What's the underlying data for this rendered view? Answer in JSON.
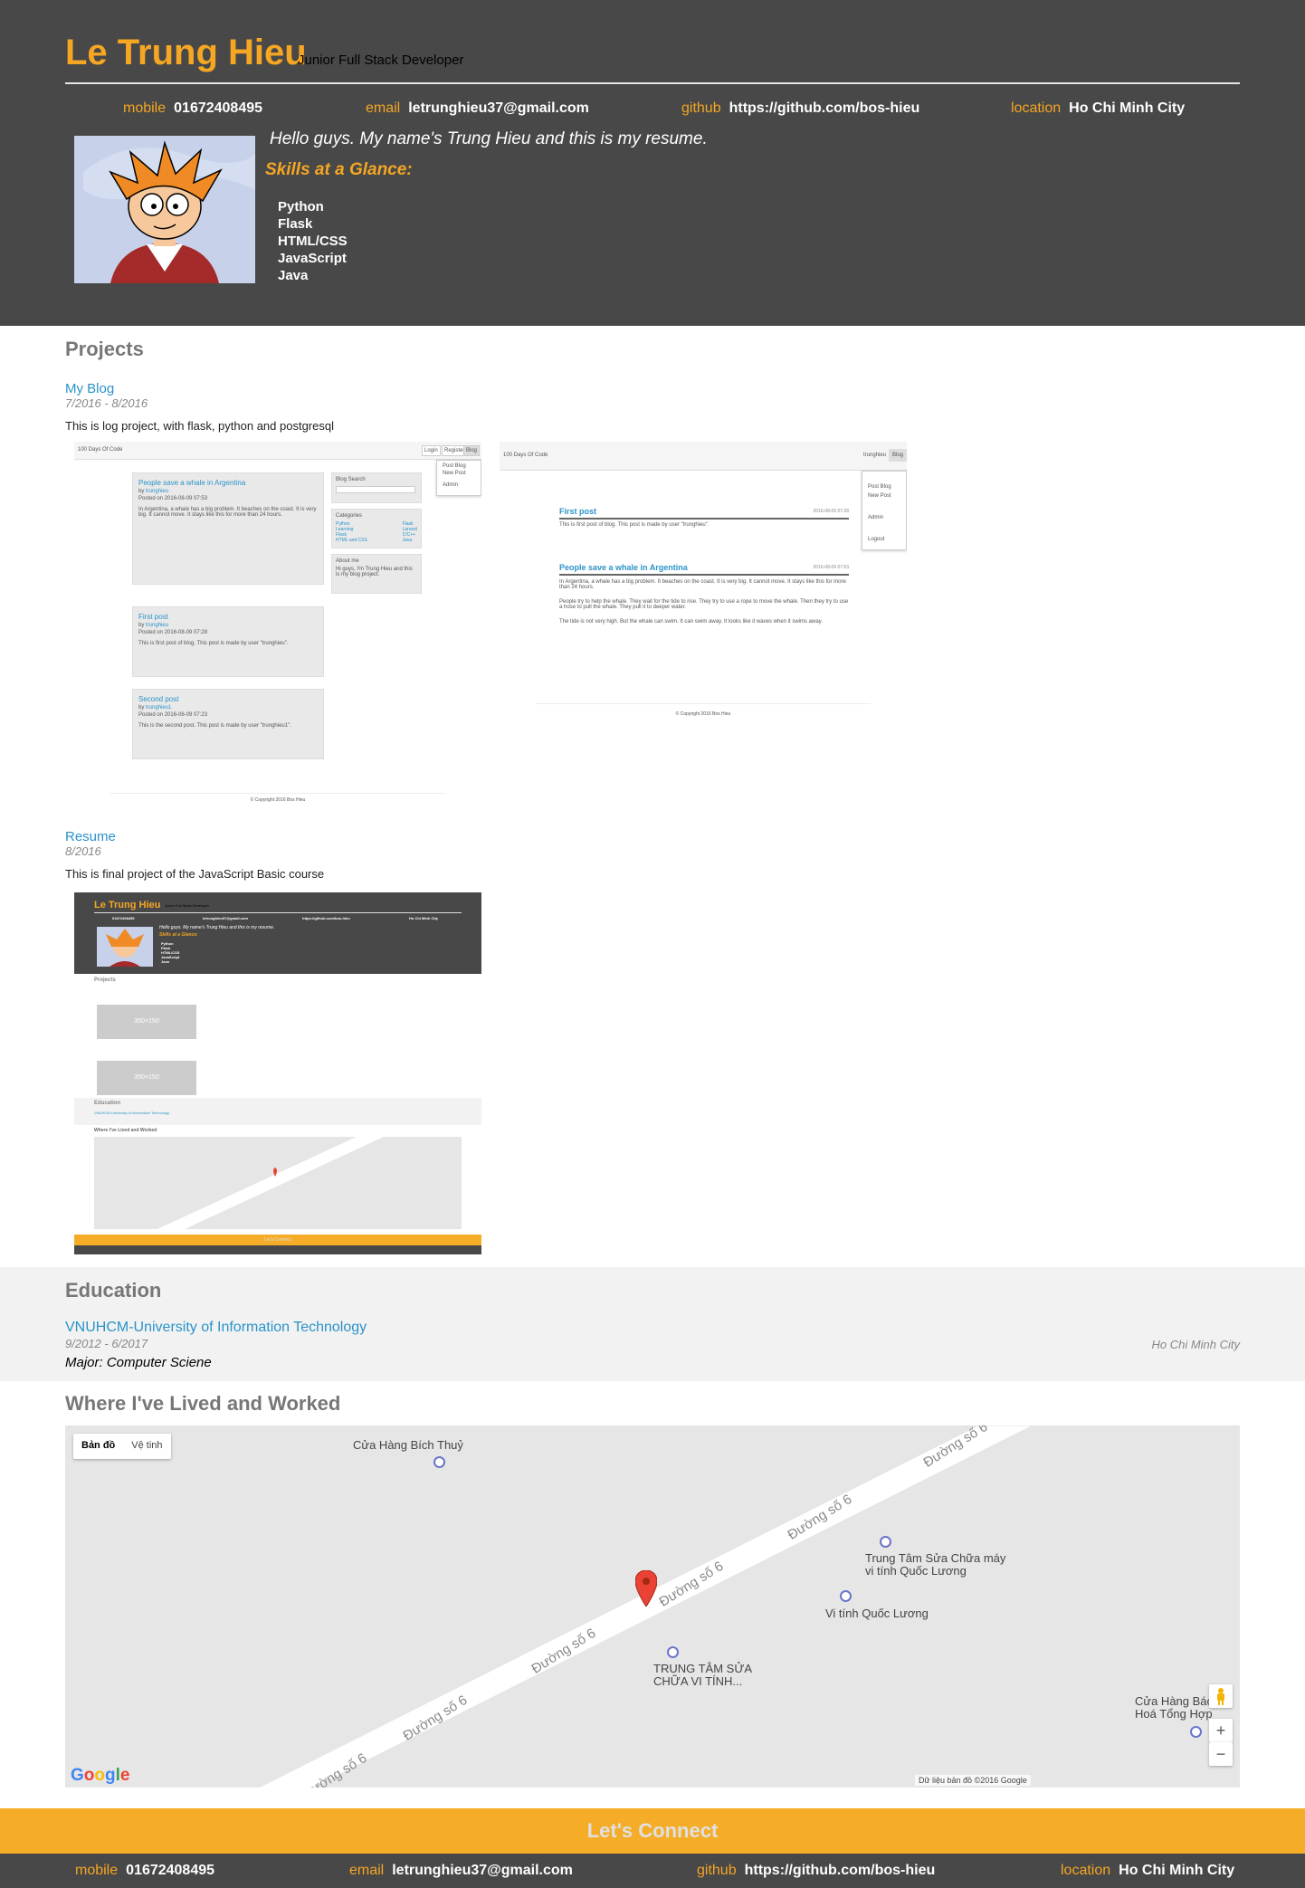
{
  "header": {
    "name": "Le Trung Hieu",
    "role": "Junior Full Stack Developer",
    "contacts": [
      {
        "label": "mobile",
        "value": "01672408495"
      },
      {
        "label": "email",
        "value": "letrunghieu37@gmail.com"
      },
      {
        "label": "github",
        "value": "https://github.com/bos-hieu"
      },
      {
        "label": "location",
        "value": "Ho Chi Minh City"
      }
    ],
    "welcome": "Hello guys. My name's Trung Hieu and this is my resume.",
    "skills_title": "Skills at a Glance:",
    "skills": [
      "Python",
      "Flask",
      "HTML/CSS",
      "JavaScript",
      "Java"
    ]
  },
  "projects": {
    "title": "Projects",
    "items": [
      {
        "title": "My Blog",
        "date": "7/2016 - 8/2016",
        "description": "This is log project, with flask, python and postgresql",
        "screenshot": {
          "brand": "100 Days Of Code",
          "nav": [
            "Login",
            "Register",
            "Blog"
          ],
          "menu": [
            "Post Blog",
            "New Post",
            "Admin"
          ],
          "posts": [
            {
              "title": "People save a whale in Argentina",
              "author": "trunghieu",
              "posted": "Posted on 2016-08-09 07:53",
              "body": "In Argentina, a whale has a big problem. It beaches on the coast. It is very big. It cannot move. It stays like this for more than 24 hours."
            },
            {
              "title": "First post",
              "author": "trunghieu",
              "posted": "Posted on 2016-08-09 07:28",
              "body": "This is first post of blog. This post is made by user \"trunghieu\"."
            },
            {
              "title": "Second post",
              "author": "trunghieu1",
              "posted": "Posted on 2016-08-09 07:23",
              "body": "This is the second post. This post is made by user \"trunghieu1\"."
            }
          ],
          "side": {
            "search": "Blog Search",
            "categories": "Categories",
            "cat_items": [
              "Python",
              "Learning",
              "Flask",
              "HTML and CSS",
              "Flask",
              "Laravel",
              "C/C++",
              "Java"
            ],
            "about_title": "About me",
            "about": "Hi guys, I'm Trung Hieu and this is my blog project."
          },
          "footer": "© Copyright 2016 Bos Hieu"
        },
        "screenshot2": {
          "brand": "100 Days Of Code",
          "user": "trunghieu",
          "menu_btn": "Blog",
          "menu": [
            "Post Blog",
            "New Post",
            "Admin",
            "Logout"
          ],
          "post1_title": "First post",
          "post1_date": "2016-08-09 07:28",
          "post1_body": "This is first post of blog. This post is made by user \"trunghieu\".",
          "post2_title": "People save a whale in Argentina",
          "post2_date": "2016-08-09 07:53",
          "post2_body": "In Argentina, a whale has a big problem. It beaches on the coast. It is very big. It cannot move. It stays like this for more than 24 hours.",
          "post2_body2": "People try to help the whale. They wait for the tide to rise. They try to use a rope to move the whale. Then they try to use a hose to pull the whale. They pull it to deeper water.",
          "post2_body3": "The tide is not very high. But the whale can swim. It can swim away. It looks like it waves when it swims away.",
          "footer": "© Copyright 2016 Bos Hieu"
        }
      },
      {
        "title": "Resume",
        "date": "8/2016",
        "description": "This is final project of the JavaScript Basic course",
        "screenshot": {
          "name": "Le Trung Hieu",
          "role": "Junior Full Stack Developer",
          "welcome": "Hello guys. My name's Trung Hieu and this is my resume.",
          "skills_title": "Skills at a Glance:",
          "skills": [
            "Python",
            "Flask",
            "HTML/CSS",
            "JavaScript",
            "Java"
          ],
          "contacts": [
            "01672408495",
            "letrunghieu37@gmail.com",
            "https://github.com/bos-hieu",
            "Ho Chi Minh City"
          ],
          "projects": "Projects",
          "placeholder": "350×150",
          "education": "Education",
          "edu_school": "VNUHCM-University of Information Technology",
          "map_title": "Where I've Lived and Worked",
          "connect": "Let's Connect"
        }
      }
    ]
  },
  "education": {
    "title": "Education",
    "school": "VNUHCM-University of Information Technology",
    "date": "9/2012 - 6/2017",
    "location": "Ho Chi Minh City",
    "major": "Major: Computer Sciene"
  },
  "map": {
    "title": "Where I've Lived and Worked",
    "toggle": [
      "Bản đồ",
      "Vệ tinh"
    ],
    "road": "Đường số 6",
    "places": [
      {
        "name": "Cửa Hàng Bích Thuỷ"
      },
      {
        "name": "Trung Tâm Sửa Chữa máy vi tính Quốc Lương"
      },
      {
        "name": "Vi tính Quốc Lương"
      },
      {
        "name": "TRUNG TÂM SỬA CHỮA VI TÍNH..."
      },
      {
        "name": "Cửa Hàng Bách Hoá Tổng Hợp"
      }
    ],
    "zoom_in": "+",
    "zoom_out": "−",
    "google": "Google",
    "attribution": "Dữ liệu bản đồ ©2016 Google",
    "colors": {
      "land": "#e6e6e6",
      "road": "#ffffff",
      "pin": "#ea4335",
      "poi": "#6a75c9"
    }
  },
  "footer": {
    "connect": "Let's Connect",
    "contacts": [
      {
        "label": "mobile",
        "value": "01672408495"
      },
      {
        "label": "email",
        "value": "letrunghieu37@gmail.com"
      },
      {
        "label": "github",
        "value": "https://github.com/bos-hieu"
      },
      {
        "label": "location",
        "value": "Ho Chi Minh City"
      }
    ]
  },
  "colors": {
    "accent": "#f5a623",
    "header_bg": "#484848",
    "link": "#2a93c9",
    "education_bg": "#f2f2f2"
  }
}
